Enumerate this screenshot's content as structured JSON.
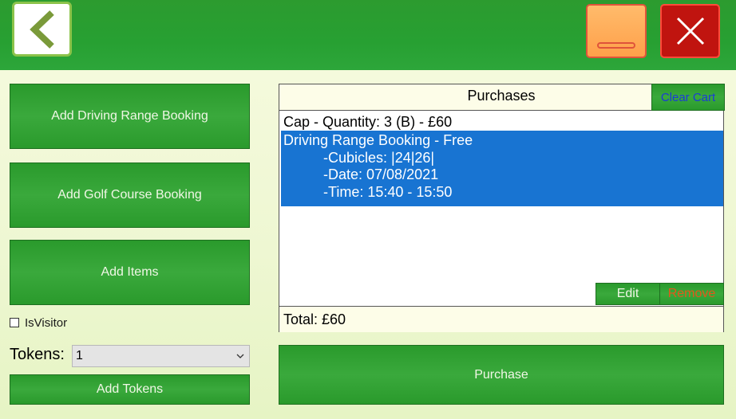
{
  "window": {
    "back_icon": "chevron-left-icon",
    "minimize_icon": "minimize-icon",
    "close_icon": "close-icon"
  },
  "left": {
    "add_driving_range_label": "Add Driving Range Booking",
    "add_golf_course_label": "Add Golf Course Booking",
    "add_items_label": "Add Items",
    "is_visitor_label": "IsVisitor",
    "is_visitor_checked": false,
    "tokens_label": "Tokens:",
    "tokens_value": "1",
    "add_tokens_label": "Add Tokens"
  },
  "purchases": {
    "title": "Purchases",
    "clear_cart_label": "Clear Cart",
    "items": [
      {
        "line": "Cap - Quantity: 3  (B) - £60"
      }
    ],
    "selected": {
      "line": "Driving Range Booking - Free",
      "cubicles": "-Cubicles: |24|26|",
      "date": "-Date: 07/08/2021",
      "time": "-Time: 15:40 - 15:50"
    },
    "edit_label": "Edit",
    "remove_label": "Remove",
    "total": "Total: £60"
  },
  "purchase_label": "Purchase",
  "colors": {
    "header_green": "#2c9b2f",
    "button_green": "#3aa93c",
    "selection_blue": "#1874d2",
    "close_red": "#c0140f",
    "minimize_orange": "#ffa04a",
    "clear_cart_text": "#1b3ad8",
    "remove_text": "#e2571b"
  }
}
